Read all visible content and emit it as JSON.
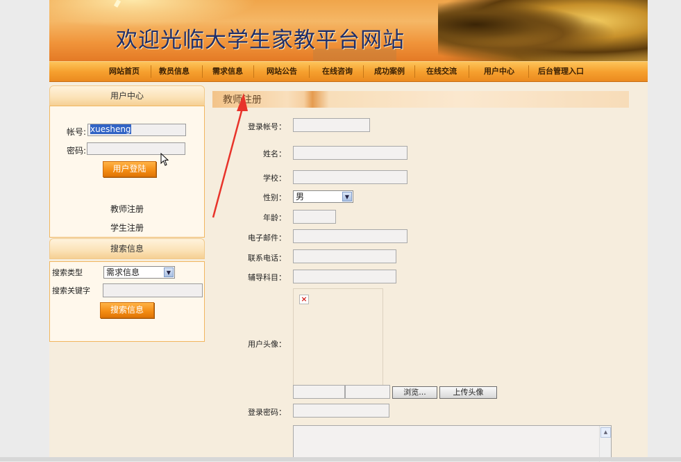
{
  "header": {
    "site_title": "欢迎光临大学生家教平台网站"
  },
  "nav": {
    "items": [
      "网站首页",
      "教员信息",
      "需求信息",
      "网站公告",
      "在线咨询",
      "成功案例",
      "在线交流",
      "用户中心",
      "后台管理入口"
    ]
  },
  "sidebar": {
    "user_center": {
      "title": "用户中心",
      "account_label": "帐号:",
      "account_value": "xuesheng",
      "password_label": "密码:",
      "login_button": "用户登陆",
      "teacher_register": "教师注册",
      "student_register": "学生注册"
    },
    "search": {
      "title": "搜索信息",
      "type_label": "搜索类型",
      "type_value": "需求信息",
      "keyword_label": "搜索关键字",
      "search_button": "搜索信息"
    }
  },
  "main": {
    "title": "教师注册",
    "fields": {
      "account": "登录帐号：",
      "name": "姓名：",
      "school": "学校：",
      "gender": "性别：",
      "gender_value": "男",
      "age": "年龄：",
      "email": "电子邮件：",
      "phone": "联系电话：",
      "subject": "辅导科目：",
      "avatar": "用户头像：",
      "password": "登录密码："
    },
    "browse_button": "浏览...",
    "upload_button": "上传头像"
  },
  "colors": {
    "nav_orange": "#f6a12f",
    "title_blue": "#1f2e6a",
    "annotation_red": "#e8332a"
  }
}
